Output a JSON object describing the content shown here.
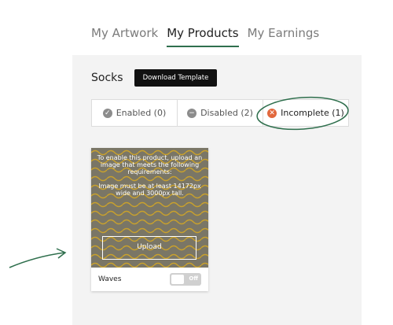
{
  "top_tabs": [
    {
      "label": "My Artwork"
    },
    {
      "label": "My Products"
    },
    {
      "label": "My Earnings"
    }
  ],
  "product": {
    "name": "Socks",
    "download_label": "Download Template"
  },
  "status_tabs": [
    {
      "label": "Enabled (0)",
      "icon": "check-circle-icon"
    },
    {
      "label": "Disabled (2)",
      "icon": "minus-circle-icon"
    },
    {
      "label": "Incomplete (1)",
      "icon": "x-circle-icon"
    }
  ],
  "card": {
    "message_line1": "To enable this product, upload an image that meets the following requirements:",
    "message_line2": "Image must be at least 14172px wide and 3000px tall.",
    "upload_label": "Upload",
    "title": "Waves",
    "toggle_label": "Off"
  },
  "colors": {
    "accent_green": "#2f6f4d",
    "incomplete_orange": "#e2683d",
    "wave": "#c9a12c",
    "card_bg": "#7a7666"
  }
}
